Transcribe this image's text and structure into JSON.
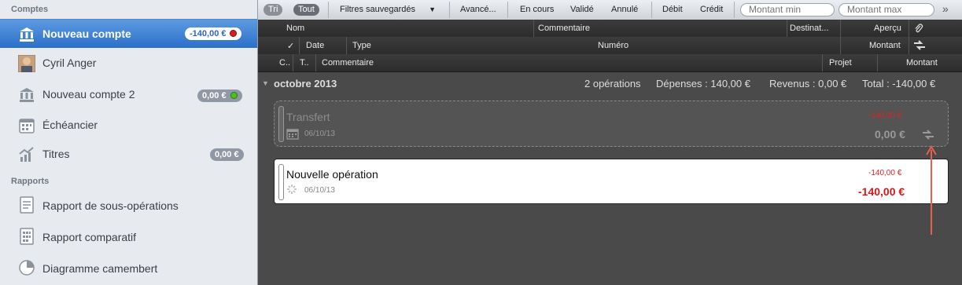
{
  "sidebar": {
    "accounts_header": "Comptes",
    "reports_header": "Rapports",
    "items": [
      {
        "label": "Nouveau compte",
        "badge": "-140,00 €"
      },
      {
        "label": "Cyril Anger"
      },
      {
        "label": "Nouveau compte 2",
        "badge": "0,00 €"
      },
      {
        "label": "Échéancier"
      },
      {
        "label": "Titres",
        "badge": "0,00 €"
      }
    ],
    "reports": [
      {
        "label": "Rapport de sous-opérations"
      },
      {
        "label": "Rapport comparatif"
      },
      {
        "label": "Diagramme camembert"
      }
    ]
  },
  "toolbar": {
    "tri": "Tri",
    "tout": "Tout",
    "filtres": "Filtres sauvegardés",
    "avance": "Avancé...",
    "en_cours": "En cours",
    "valide": "Validé",
    "annule": "Annulé",
    "debit": "Débit",
    "credit": "Crédit",
    "min_placeholder": "Montant min",
    "max_placeholder": "Montant max"
  },
  "headers": {
    "row1": {
      "nom": "Nom",
      "commentaire": "Commentaire",
      "destinat": "Destinat...",
      "apercu": "Aperçu"
    },
    "row2": {
      "check": "✓",
      "date": "Date",
      "type": "Type",
      "numero": "Numéro",
      "montant": "Montant"
    },
    "row3": {
      "c": "C..",
      "t": "T..",
      "commentaire": "Commentaire",
      "projet": "Projet",
      "montant": "Montant"
    }
  },
  "month": {
    "label": "octobre 2013",
    "operations": "2 opérations",
    "depenses": "Dépenses : 140,00 €",
    "revenus": "Revenus : 0,00 €",
    "total": "Total : -140,00 €"
  },
  "transactions": [
    {
      "title": "Transfert",
      "date": "06/10/13",
      "amount_top": "-140,00 €",
      "amount": "0,00 €"
    },
    {
      "title": "Nouvelle opération",
      "date": "06/10/13",
      "amount_top": "-140,00 €",
      "amount": "-140,00 €"
    }
  ],
  "colors": {
    "accent": "#2b6fc8",
    "negative": "#d3181a",
    "arrow": "#e8604c"
  }
}
